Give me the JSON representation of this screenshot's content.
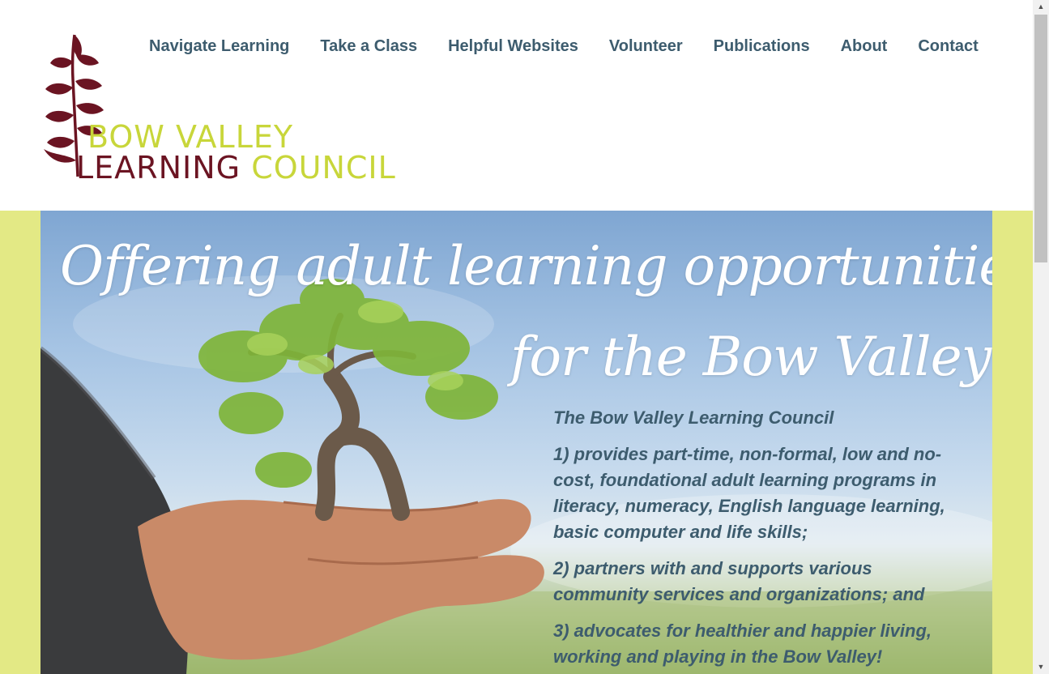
{
  "logo": {
    "line1": "BOW VALLEY",
    "line2_first": "LEARNING",
    "line2_second": "COUNCIL",
    "colors": {
      "maroon": "#6b1422",
      "lime": "#c8d63a"
    }
  },
  "nav": {
    "items": [
      {
        "label": "Navigate Learning"
      },
      {
        "label": "Take a Class"
      },
      {
        "label": "Helpful Websites"
      },
      {
        "label": "Volunteer"
      },
      {
        "label": "Publications"
      },
      {
        "label": "About"
      },
      {
        "label": "Contact"
      }
    ],
    "color": "#3d5c6e"
  },
  "hero": {
    "headline_line1": "Offering adult learning opportunities",
    "headline_line2": "for the Bow Valley",
    "intro": "The Bow Valley Learning Council",
    "points": [
      "1) provides part-time, non-formal, low and no-cost, foundational adult learning programs in literacy, numeracy, English language learning, basic computer and life skills;",
      "2) partners with and supports various community services and organizations; and",
      "3) advocates for healthier and happier living, working and playing in the Bow Valley!"
    ],
    "band_color": "#e3e985"
  },
  "scrollbar": {
    "up_icon": "▲",
    "down_icon": "▼"
  }
}
